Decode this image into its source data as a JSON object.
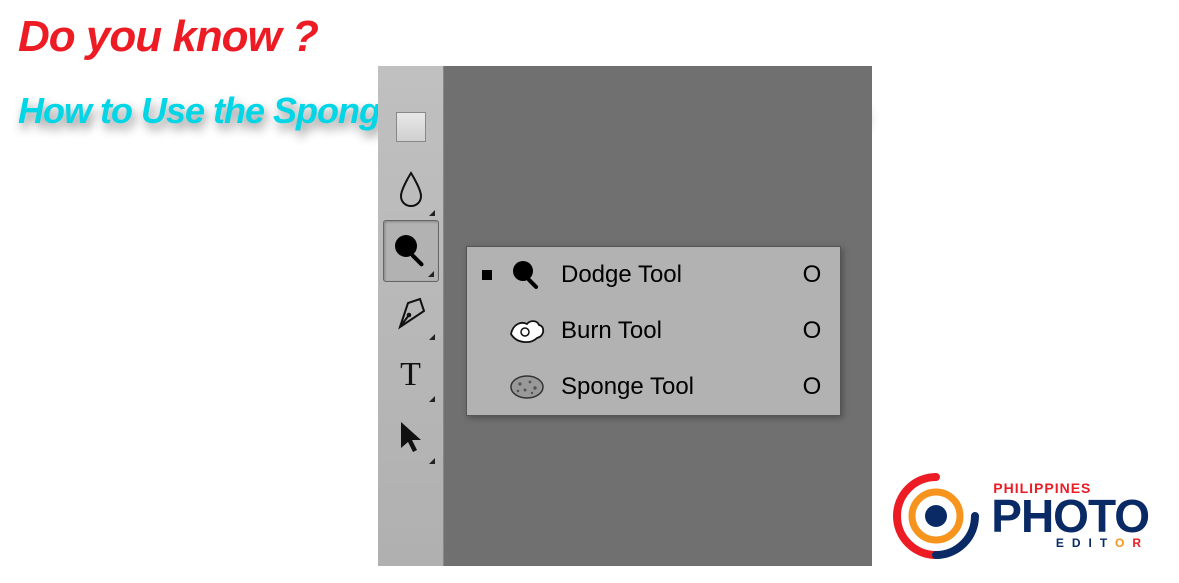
{
  "heading1": "Do you know ?",
  "heading2": "How to Use the Sponge Tool in Photoshop Elements",
  "flyout": {
    "items": [
      {
        "label": "Dodge Tool",
        "shortcut": "O",
        "active": true
      },
      {
        "label": "Burn Tool",
        "shortcut": "O",
        "active": false
      },
      {
        "label": "Sponge Tool",
        "shortcut": "O",
        "active": false
      }
    ]
  },
  "logo": {
    "line1": "PHILIPPINES",
    "line2": "PHOTO",
    "line3_parts": [
      "EDIT",
      "O",
      "R"
    ]
  }
}
